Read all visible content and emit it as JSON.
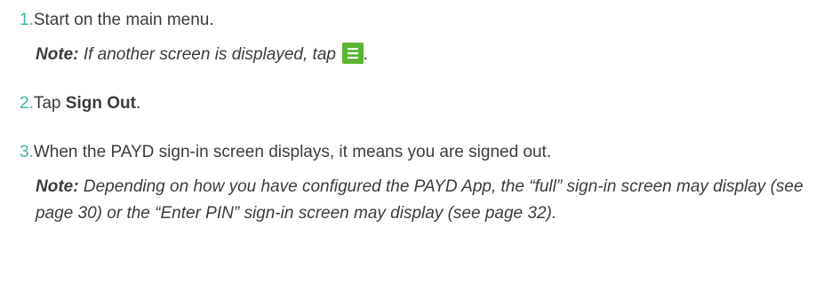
{
  "colors": {
    "step_number": "#3fb4a4",
    "menu_icon_bg": "#5cb531",
    "text": "#3c3c3c"
  },
  "steps": [
    {
      "number": "1.",
      "text": "Start on the main menu.",
      "note": {
        "label": "Note:",
        "text_before_icon": " If another screen is displayed, tap ",
        "icon": "menu-hamburger-icon",
        "text_after_icon": "."
      }
    },
    {
      "number": "2.",
      "text_before": "Tap ",
      "bold": "Sign Out",
      "text_after": "."
    },
    {
      "number": "3.",
      "text": "When the PAYD sign-in screen displays, it means you are signed out.",
      "note": {
        "label": "Note:",
        "text": " Depending on how you have configured the PAYD App, the “full” sign-in screen may display (see page 30) or the “Enter PIN” sign-in screen may display (see page 32)."
      }
    }
  ]
}
